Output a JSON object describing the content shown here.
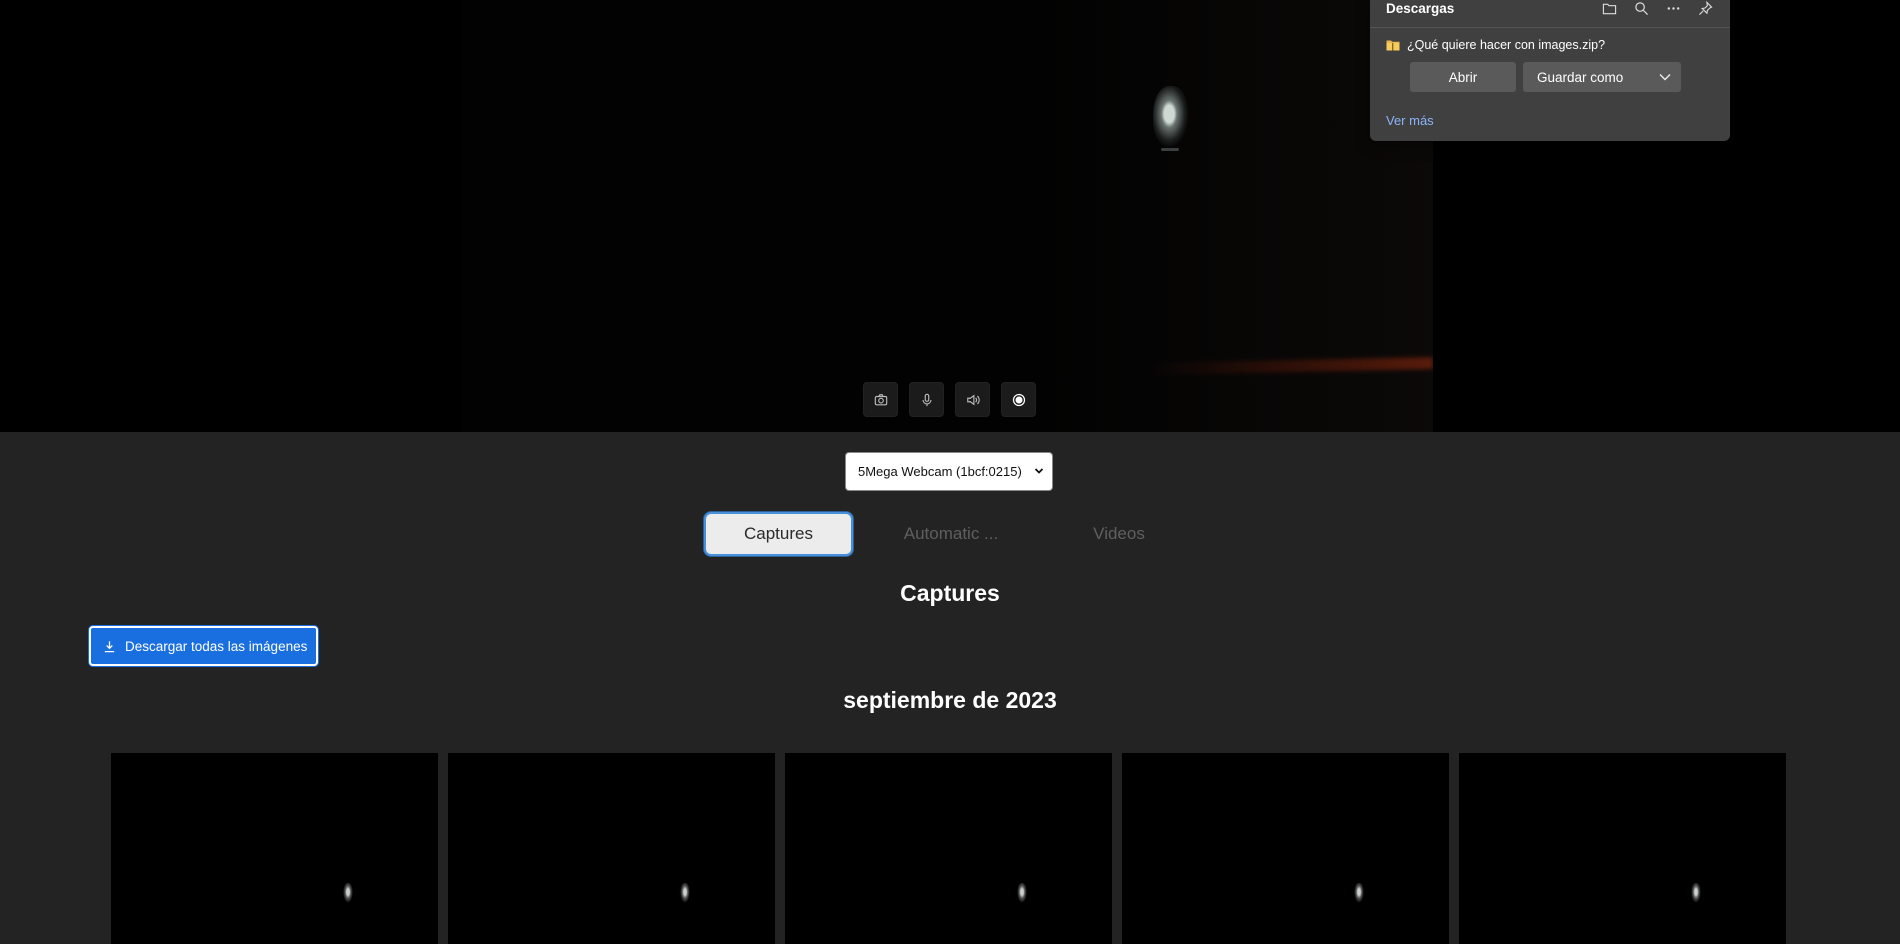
{
  "controls": {
    "camera_icon": "camera-icon",
    "mic_icon": "microphone-icon",
    "speaker_icon": "speaker-icon",
    "record_icon": "record-icon"
  },
  "camera_select": {
    "selected": "5Mega Webcam (1bcf:0215)"
  },
  "tabs": [
    {
      "label": "Captures",
      "active": true
    },
    {
      "label": "Automatic ...",
      "active": false
    },
    {
      "label": "Videos",
      "active": false
    }
  ],
  "section_title": "Captures",
  "download_all": {
    "label": "Descargar todas las imágenes",
    "color": "#1a6fe0"
  },
  "month_title": "septiembre de 2023",
  "gallery": {
    "thumbnails": [
      "captura-1",
      "captura-2",
      "captura-3",
      "captura-4",
      "captura-5"
    ]
  },
  "downloads_flyout": {
    "title": "Descargas",
    "question": "¿Qué quiere hacer con images.zip?",
    "open_label": "Abrir",
    "save_label": "Guardar como",
    "see_more": "Ver más",
    "link_color": "#8ab4f8"
  }
}
